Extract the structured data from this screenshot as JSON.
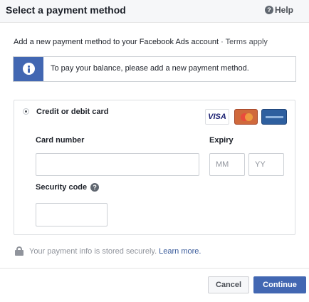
{
  "header": {
    "title": "Select a payment method",
    "help_label": "Help",
    "help_icon": "question-icon"
  },
  "intro": {
    "text": "Add a new payment method to your Facebook Ads account",
    "separator": " · ",
    "terms_link": "Terms apply"
  },
  "notice": {
    "icon": "info-icon",
    "text": "To pay your balance, please add a new payment method."
  },
  "payment_method": {
    "label": "Credit or debit card",
    "selected": true,
    "card_logos": [
      "visa-logo",
      "mastercard-logo",
      "amex-logo"
    ],
    "visa_text": "VISA"
  },
  "fields": {
    "card_number_label": "Card number",
    "card_number_value": "",
    "expiry_label": "Expiry",
    "month_placeholder": "MM",
    "year_placeholder": "YY",
    "security_code_label": "Security code",
    "security_code_value": ""
  },
  "secure_note": {
    "text": "Your payment info is stored securely.",
    "link": "Learn more."
  },
  "footer": {
    "cancel_label": "Cancel",
    "continue_label": "Continue"
  },
  "colors": {
    "accent": "#4267b2",
    "link": "#365899",
    "muted": "#90949c"
  }
}
